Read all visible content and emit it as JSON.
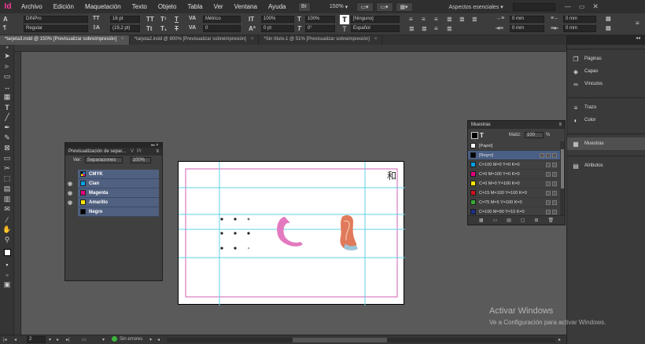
{
  "app": {
    "logo": "Id"
  },
  "menubar": {
    "items": [
      "Archivo",
      "Edición",
      "Maquetación",
      "Texto",
      "Objeto",
      "Tabla",
      "Ver",
      "Ventana",
      "Ayuda"
    ],
    "br_label": "Br",
    "zoom": "150%",
    "workspace": "Aspectos esenciales"
  },
  "control": {
    "font_family": "DINPro",
    "font_style": "Regular",
    "font_size": "16 pt",
    "leading": "(19,2 pt)",
    "kerning": "Métrico",
    "tracking": "0",
    "h_scale": "100%",
    "v_scale": "100%",
    "baseline": "0 pt",
    "skew": "0°",
    "char_style": "[Ninguno]",
    "language": "Español",
    "indent_1": "0 mm",
    "indent_2": "0 mm",
    "indent_3": "0 mm",
    "indent_4": "0 mm"
  },
  "tabs": [
    {
      "label": "*tarjeta3.indd @ 150% [Previsualizar sobreimpresión]",
      "active": true
    },
    {
      "label": "*tarjeta2.indd @ 800% [Previsualizar sobreimpresión]",
      "active": false
    },
    {
      "label": "*Sin título-1 @ 51% [Previsualizar sobreimpresión]",
      "active": false
    }
  ],
  "separations": {
    "title": "Previsualización de separ...",
    "tab2": "V",
    "tab3": "Pr",
    "view_label": "Ver:",
    "view_value": "Separaciones",
    "zoom_value": "100%",
    "rows": [
      {
        "name": "CMYK",
        "color": "cmyk",
        "eye": false
      },
      {
        "name": "Cian",
        "color": "#00a0e3",
        "eye": true
      },
      {
        "name": "Magenta",
        "color": "#e5007e",
        "eye": true
      },
      {
        "name": "Amarillo",
        "color": "#ffe500",
        "eye": true
      },
      {
        "name": "Negro",
        "color": "#000000",
        "eye": false
      }
    ]
  },
  "swatches": {
    "title": "Muestras",
    "tint_label": "Matiz:",
    "tint_value": "100",
    "tint_unit": "%",
    "rows": [
      {
        "name": "[Papel]",
        "color": "#ffffff",
        "selected": false
      },
      {
        "name": "[Negro]",
        "color": "#000000",
        "selected": true
      },
      {
        "name": "C=100 M=0 Y=0 K=0",
        "color": "#00a0e3",
        "selected": false
      },
      {
        "name": "C=0 M=100 Y=0 K=0",
        "color": "#e5007e",
        "selected": false
      },
      {
        "name": "C=0 M=0 Y=100 K=0",
        "color": "#ffe500",
        "selected": false
      },
      {
        "name": "C=15 M=100 Y=100 K=0",
        "color": "#d0101f",
        "selected": false
      },
      {
        "name": "C=75 M=5 Y=100 K=0",
        "color": "#3aa935",
        "selected": false
      },
      {
        "name": "C=100 M=90 Y=10 K=0",
        "color": "#1d2f8a",
        "selected": false
      }
    ]
  },
  "dock": {
    "group1": [
      {
        "label": "Páginas",
        "icon": "pages-icon"
      },
      {
        "label": "Capas",
        "icon": "layers-icon"
      },
      {
        "label": "Vínculos",
        "icon": "links-icon"
      }
    ],
    "group2": [
      {
        "label": "Trazo",
        "icon": "stroke-icon"
      },
      {
        "label": "Color",
        "icon": "color-icon"
      }
    ],
    "group3": [
      {
        "label": "Muestras",
        "icon": "swatches-icon"
      }
    ],
    "group4": [
      {
        "label": "Atributos",
        "icon": "attributes-icon"
      }
    ]
  },
  "document": {
    "kanji": "和",
    "accent_magenta": "#e37ac0",
    "guide_cyan": "#5fd3e6"
  },
  "status": {
    "page": "2",
    "preflight": "Sin errores"
  },
  "watermark": {
    "title": "Activar Windows",
    "subtitle": "Ve a Configuración para activar Windows."
  }
}
